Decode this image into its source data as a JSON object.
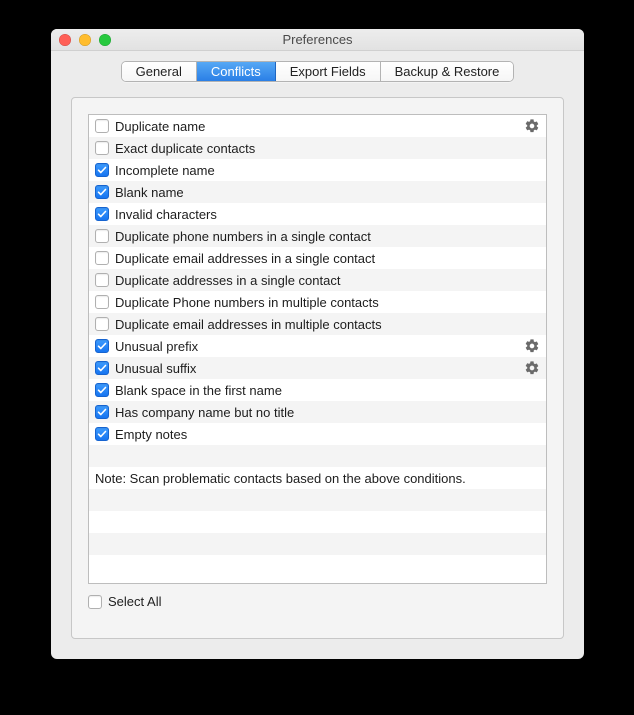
{
  "window": {
    "title": "Preferences"
  },
  "tabs": [
    {
      "label": "General",
      "active": false
    },
    {
      "label": "Conflicts",
      "active": true
    },
    {
      "label": "Export Fields",
      "active": false
    },
    {
      "label": "Backup & Restore",
      "active": false
    }
  ],
  "items": [
    {
      "label": "Duplicate name",
      "checked": false,
      "has_gear": true
    },
    {
      "label": "Exact duplicate contacts",
      "checked": false,
      "has_gear": false
    },
    {
      "label": "Incomplete name",
      "checked": true,
      "has_gear": false
    },
    {
      "label": "Blank name",
      "checked": true,
      "has_gear": false
    },
    {
      "label": "Invalid characters",
      "checked": true,
      "has_gear": false
    },
    {
      "label": "Duplicate phone numbers in a single contact",
      "checked": false,
      "has_gear": false
    },
    {
      "label": "Duplicate email addresses in a single contact",
      "checked": false,
      "has_gear": false
    },
    {
      "label": "Duplicate addresses in a single contact",
      "checked": false,
      "has_gear": false
    },
    {
      "label": "Duplicate Phone numbers in multiple contacts",
      "checked": false,
      "has_gear": false
    },
    {
      "label": "Duplicate email addresses in multiple contacts",
      "checked": false,
      "has_gear": false
    },
    {
      "label": "Unusual prefix",
      "checked": true,
      "has_gear": true
    },
    {
      "label": "Unusual suffix",
      "checked": true,
      "has_gear": true
    },
    {
      "label": "Blank space in the first name",
      "checked": true,
      "has_gear": false
    },
    {
      "label": "Has company name but no title",
      "checked": true,
      "has_gear": false
    },
    {
      "label": "Empty notes",
      "checked": true,
      "has_gear": false
    }
  ],
  "note": "Note: Scan problematic contacts based on the above conditions.",
  "select_all": {
    "label": "Select All",
    "checked": false
  }
}
